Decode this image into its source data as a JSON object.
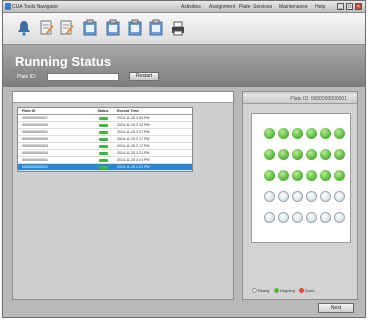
{
  "window": {
    "title": "CUA Tools Navigator",
    "menu": [
      "Activities",
      "Assignment",
      "Plate",
      "Services",
      "Maintenance",
      "Help"
    ],
    "controls": [
      "_",
      "□",
      "×"
    ]
  },
  "toolbar": {
    "icons": [
      "bell-icon",
      "edit-doc-icon",
      "edit-doc-icon",
      "clipboard-icon",
      "clipboard-icon",
      "clipboard-icon",
      "clipboard-icon",
      "printer-icon"
    ]
  },
  "header": {
    "title": "Running Status",
    "plate_id_label": "Plate ID:",
    "plate_id_value": "",
    "reset_label": "Restart"
  },
  "table": {
    "columns": [
      "Plate ID",
      "Status",
      "Record Time"
    ],
    "rows": [
      {
        "id": "0000000000007",
        "time": "2014-11-25 2:54 PM",
        "selected": false
      },
      {
        "id": "0000000000003",
        "time": "2014-11-25 2:12 PM",
        "selected": false
      },
      {
        "id": "0000000000001",
        "time": "2014-11-25 2:17 PM",
        "selected": false
      },
      {
        "id": "0000000000003",
        "time": "2014-11-25 2:17 PM",
        "selected": false
      },
      {
        "id": "0000000000003",
        "time": "2014-11-25 2:17 PM",
        "selected": false
      },
      {
        "id": "0000000000004",
        "time": "2014-11-25 2:21 PM",
        "selected": false
      },
      {
        "id": "0000000000001",
        "time": "2014-11-25 2:21 PM",
        "selected": false
      },
      {
        "id": "0000000000001",
        "time": "2014-11-25 2:21 PM",
        "selected": true
      }
    ]
  },
  "plate": {
    "id_label": "Plate ID:",
    "id_value": "0000000000001",
    "wells_done": 18,
    "wells_total": 30,
    "columns": 6
  },
  "legend": {
    "items": [
      {
        "label": "Ready",
        "color": "#dfe6ea"
      },
      {
        "label": "Ongoing",
        "color": "#58b83a"
      },
      {
        "label": "Done",
        "color": "#e04a2c"
      }
    ]
  },
  "buttons": {
    "next_label": "Next"
  },
  "colors": {
    "accent": "#2c86d4",
    "done_well": "#58b83a",
    "status_green": "#3fb63d"
  }
}
